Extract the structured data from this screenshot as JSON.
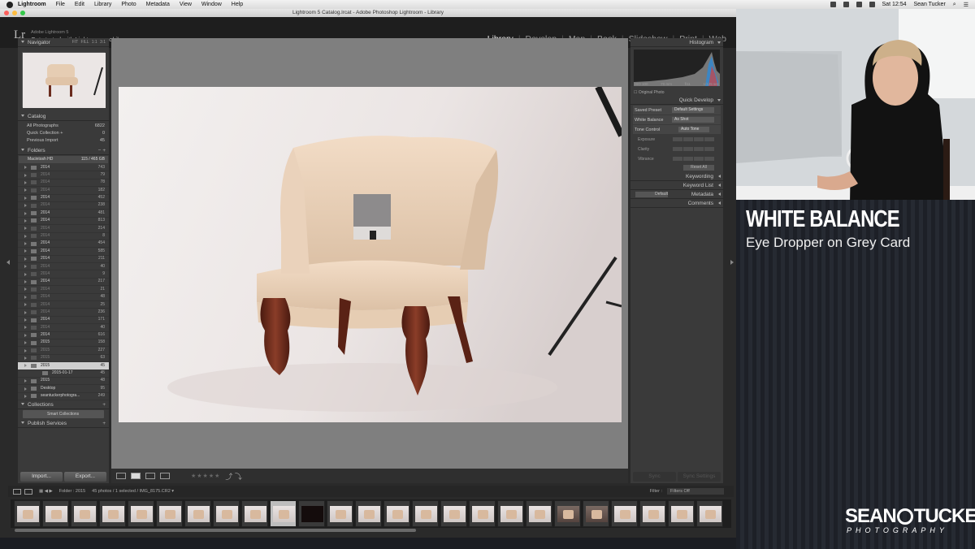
{
  "menubar": {
    "app": "Lightroom",
    "items": [
      "File",
      "Edit",
      "Library",
      "Photo",
      "Metadata",
      "View",
      "Window",
      "Help"
    ],
    "clock": "Sat 12:54",
    "user": "Sean Tucker"
  },
  "window": {
    "title": "Lightroom 5 Catalog.lrcat - Adobe Photoshop Lightroom - Library"
  },
  "identity": {
    "logo": "Lr",
    "version": "Adobe Lightroom 5",
    "subtitle": "Get started with Lightroom mobile ▸"
  },
  "modules": [
    {
      "label": "Library",
      "active": true
    },
    {
      "label": "Develop",
      "active": false
    },
    {
      "label": "Map",
      "active": false
    },
    {
      "label": "Book",
      "active": false
    },
    {
      "label": "Slideshow",
      "active": false
    },
    {
      "label": "Print",
      "active": false
    },
    {
      "label": "Web",
      "active": false
    }
  ],
  "left": {
    "navigator": {
      "title": "Navigator",
      "options": "FIT FILL 1:1 3:1"
    },
    "catalog": {
      "title": "Catalog",
      "items": [
        {
          "label": "All Photographs",
          "count": "6822"
        },
        {
          "label": "Quick Collection +",
          "count": "0"
        },
        {
          "label": "Previous Import",
          "count": "45"
        }
      ]
    },
    "folders": {
      "title": "Folders",
      "volume": "Macintosh HD",
      "volume_info": "115 / 465 GB",
      "items": [
        {
          "label": "2014",
          "count": "743",
          "dim": false
        },
        {
          "label": "2014",
          "count": "79",
          "dim": true
        },
        {
          "label": "2014",
          "count": "78",
          "dim": true
        },
        {
          "label": "2014",
          "count": "182",
          "dim": true
        },
        {
          "label": "2014",
          "count": "452",
          "dim": false
        },
        {
          "label": "2014",
          "count": "238",
          "dim": true
        },
        {
          "label": "2014",
          "count": "481",
          "dim": false
        },
        {
          "label": "2014",
          "count": "813",
          "dim": false
        },
        {
          "label": "2014",
          "count": "214",
          "dim": true
        },
        {
          "label": "2014",
          "count": "8",
          "dim": true
        },
        {
          "label": "2014",
          "count": "454",
          "dim": false
        },
        {
          "label": "2014",
          "count": "585",
          "dim": false
        },
        {
          "label": "2014",
          "count": "211",
          "dim": false
        },
        {
          "label": "2014",
          "count": "40",
          "dim": true
        },
        {
          "label": "2014",
          "count": "9",
          "dim": true
        },
        {
          "label": "2014",
          "count": "217",
          "dim": false
        },
        {
          "label": "2014",
          "count": "21",
          "dim": true
        },
        {
          "label": "2014",
          "count": "48",
          "dim": true
        },
        {
          "label": "2014",
          "count": "25",
          "dim": true
        },
        {
          "label": "2014",
          "count": "236",
          "dim": true
        },
        {
          "label": "2014",
          "count": "171",
          "dim": false
        },
        {
          "label": "2014",
          "count": "40",
          "dim": true
        },
        {
          "label": "2014",
          "count": "616",
          "dim": false
        },
        {
          "label": "2015",
          "count": "158",
          "dim": false
        },
        {
          "label": "2015",
          "count": "227",
          "dim": true
        },
        {
          "label": "2015",
          "count": "63",
          "dim": true
        },
        {
          "label": "2015",
          "count": "45",
          "dim": false,
          "selected": true
        },
        {
          "label": "2015-01-17",
          "count": "45",
          "dim": false,
          "child": true
        },
        {
          "label": "2015",
          "count": "48",
          "dim": false
        },
        {
          "label": "Desktop",
          "count": "95",
          "dim": false
        },
        {
          "label": "seantuckerphotogra...",
          "count": "249",
          "dim": false
        }
      ]
    },
    "collections": {
      "title": "Collections",
      "smart": "Smart Collections"
    },
    "publish": {
      "title": "Publish Services"
    },
    "import_label": "Import...",
    "export_label": "Export..."
  },
  "right": {
    "histogram_title": "Histogram",
    "hist_info": [
      "ISO 100",
      "70 mm",
      "f/11",
      "1/125 sec"
    ],
    "original_photo": "Original Photo",
    "quick_develop": "Quick Develop",
    "saved_preset_label": "Saved Preset",
    "saved_preset_value": "Default Settings",
    "white_balance_label": "White Balance",
    "white_balance_value": "As Shot",
    "tone_control": "Tone Control",
    "auto_tone": "Auto Tone",
    "exposure": "Exposure",
    "clarity": "Clarity",
    "vibrance": "Vibrance",
    "reset_all": "Reset All",
    "keywording": "Keywording",
    "keyword_list": "Keyword List",
    "metadata": "Metadata",
    "metadata_preset": "Default",
    "comments": "Comments",
    "sync_label": "Sync",
    "sync_settings_label": "Sync Settings"
  },
  "filmstrip": {
    "folder": "Folder : 2015",
    "info": "45 photos / 1 selected / IMG_8175.CR2 ▾",
    "filter_label": "Filter :",
    "filter_value": "Filters Off"
  },
  "overlay": {
    "title": "WHITE BALANCE",
    "subtitle": "Eye Dropper on Grey Card",
    "brand_left": "SEAN",
    "brand_right": "TUCKER",
    "brand_sub": "PHOTOGRAPHY"
  },
  "colors": {
    "lr_bg": "#2a2a2a",
    "panel": "#3a3a3a",
    "center": "#7f7f7f",
    "accent_white": "#ffffff"
  }
}
